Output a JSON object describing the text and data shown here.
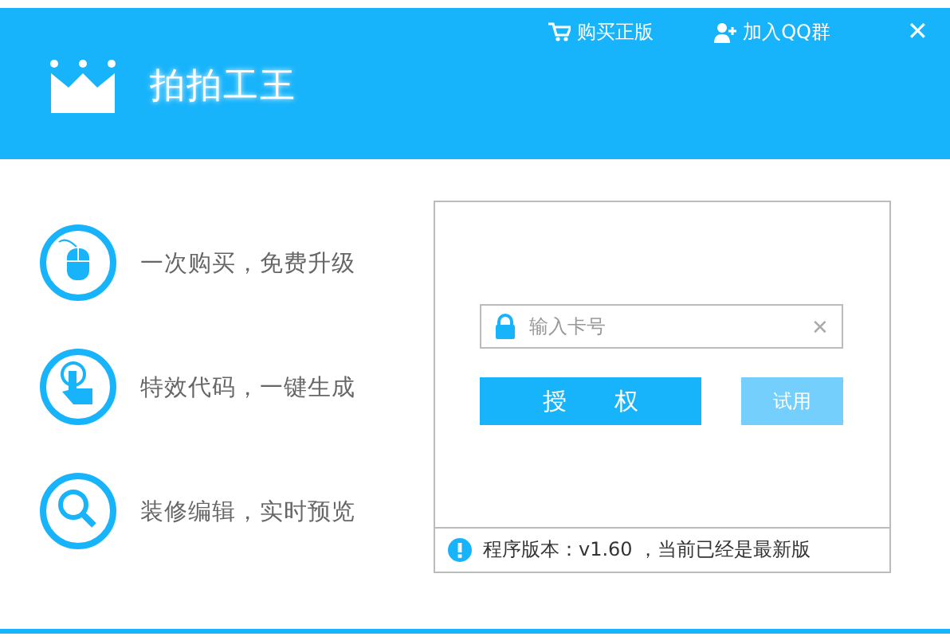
{
  "header": {
    "logo_text": "拍拍工王",
    "links": [
      {
        "kind": "cart",
        "label": "购买正版"
      },
      {
        "kind": "user-add",
        "label": "加入QQ群"
      }
    ],
    "close": "✕"
  },
  "features": [
    {
      "kind": "mouse",
      "text": "一次购买，免费升级"
    },
    {
      "kind": "hand",
      "text": "特效代码，一键生成"
    },
    {
      "kind": "search",
      "text": "装修编辑，实时预览"
    }
  ],
  "license": {
    "placeholder": "输入卡号",
    "clear": "✕",
    "authorize": "授　　权",
    "trial": "试用",
    "trial_disabled": true,
    "status": "程序版本：v1.60 ，当前已经是最新版"
  }
}
